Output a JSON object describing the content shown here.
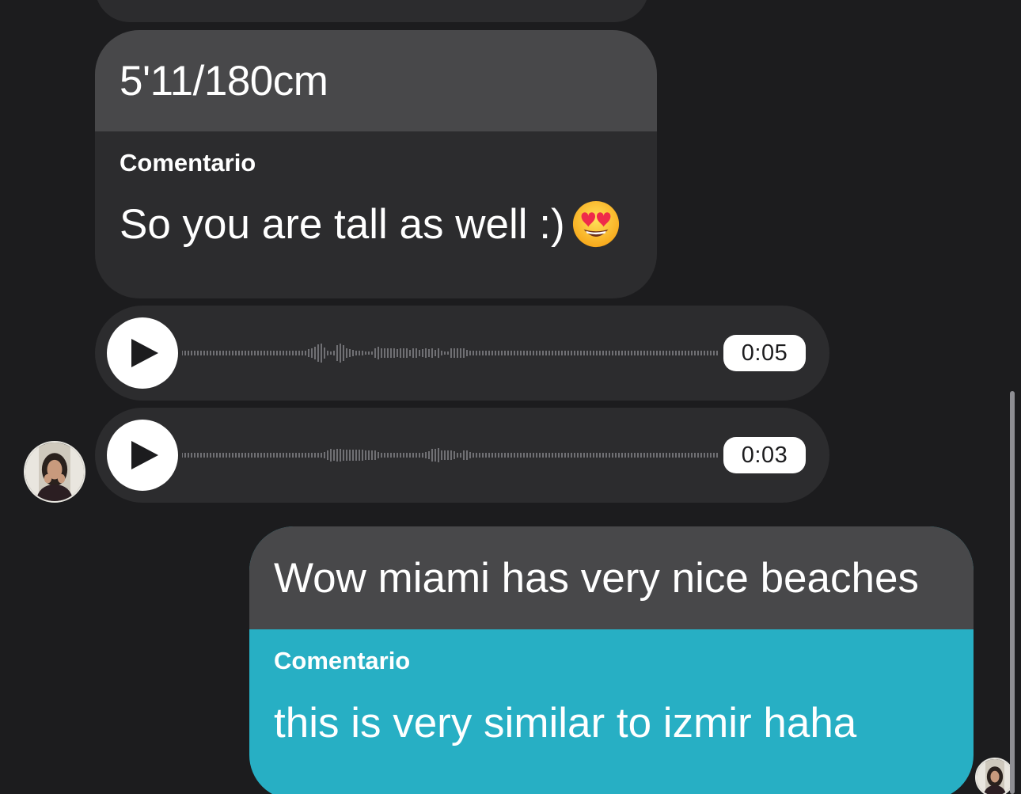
{
  "conversation": {
    "incoming_quote": {
      "quoted_text": "5'11/180cm",
      "comment_label": "Comentario",
      "comment_text": "So you are tall as well :)",
      "emoji": "heart-eyes-emoji"
    },
    "voice_messages": [
      {
        "duration": "0:05",
        "icon": "play-icon"
      },
      {
        "duration": "0:03",
        "icon": "play-icon"
      }
    ],
    "outgoing_quote": {
      "quoted_text": "Wow miami has very nice beaches",
      "comment_label": "Comentario",
      "comment_text": "this is very similar to izmir haha"
    }
  },
  "colors": {
    "background": "#1c1c1e",
    "incoming_bubble": "#2c2c2e",
    "quoted_bubble": "#48484a",
    "outgoing_bubble": "#27afc4",
    "text": "#ffffff"
  }
}
